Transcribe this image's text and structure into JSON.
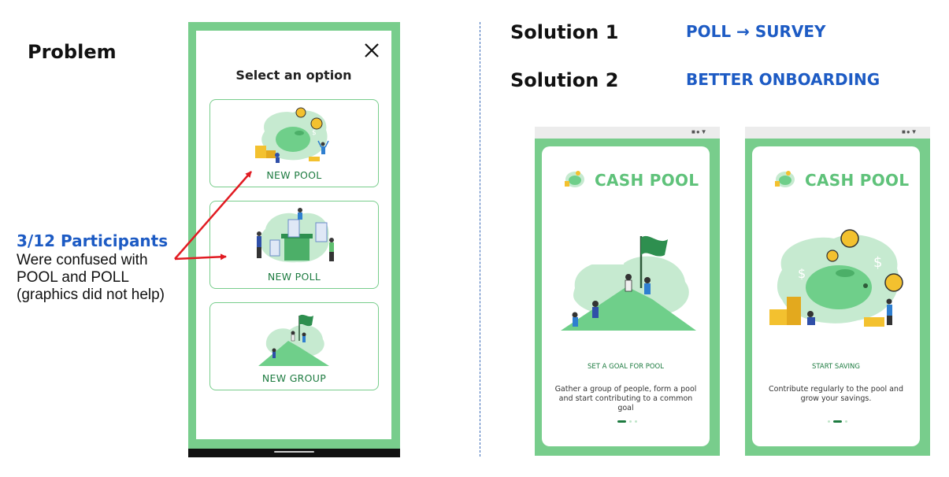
{
  "problem": {
    "heading": "Problem",
    "note_title": "3/12 Participants",
    "note_lines": [
      "Were confused with",
      "POOL and POLL",
      "(graphics did not help)"
    ]
  },
  "phone": {
    "close_icon": "close-icon",
    "title": "Select an option",
    "options": [
      {
        "label": "NEW POOL",
        "icon": "piggy-bank-illustration"
      },
      {
        "label": "NEW POLL",
        "icon": "voting-illustration"
      },
      {
        "label": "NEW GROUP",
        "icon": "mountain-flag-illustration"
      }
    ]
  },
  "solutions": [
    {
      "label": "Solution 1",
      "value": "POLL → SURVEY"
    },
    {
      "label": "Solution 2",
      "value": "BETTER ONBOARDING"
    }
  ],
  "onboarding": [
    {
      "brand": "CASH POOL",
      "step_title": "SET A GOAL FOR POOL",
      "desc": "Gather a group of people, form a pool and start contributing to a common goal",
      "active_dot": 0
    },
    {
      "brand": "CASH POOL",
      "step_title": "START SAVING",
      "desc": "Contribute regularly to the pool and grow your savings.",
      "active_dot": 1
    }
  ],
  "colors": {
    "accent_blue": "#1d5bc4",
    "brand_green": "#78cd8c",
    "dark_green": "#1d7b40",
    "arrow_red": "#e11b22"
  }
}
